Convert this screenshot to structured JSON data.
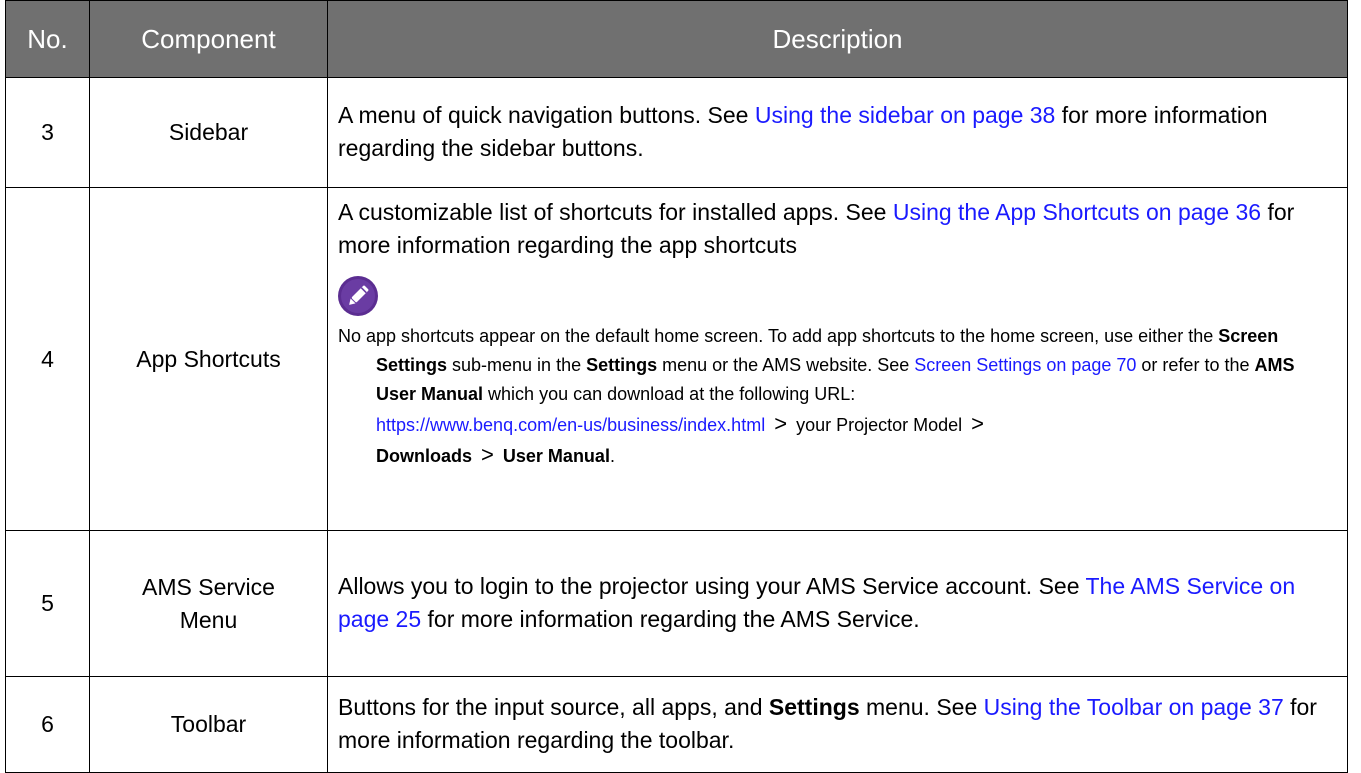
{
  "headers": {
    "no": "No.",
    "component": "Component",
    "description": "Description"
  },
  "rows": [
    {
      "no": "3",
      "component": "Sidebar",
      "desc": {
        "t1": "A menu of quick navigation buttons. See ",
        "link1": "Using the sidebar on page 38",
        "t2": " for more information regarding the sidebar buttons."
      }
    },
    {
      "no": "4",
      "component": "App Shortcuts",
      "desc": {
        "t1": "A customizable list of shortcuts for installed apps. See ",
        "link1": "Using the App Shortcuts on page 36",
        "t2": " for more information regarding the app shortcuts"
      },
      "note": {
        "icon": "pencil-note-icon",
        "icon_color": "#5b2d91",
        "p1": "No app shortcuts appear on the default home screen. To add app shortcuts to the home screen, use either the ",
        "b1": "Screen Settings",
        "p2": " sub-menu in the ",
        "b2": "Settings",
        "p3": " menu or the AMS website. See ",
        "link1": "Screen Settings on page 70",
        "p4": " or refer to the ",
        "b3": "AMS User Manual",
        "p5": " which you can download at the following URL: ",
        "url": "https://www.benq.com/en-us/business/index.html",
        "gt1": ">",
        "p6": " your Projector Model ",
        "gt2": ">",
        "b4": "Downloads",
        "gt3": ">",
        "b5": "User Manual",
        "p7": "."
      }
    },
    {
      "no": "5",
      "component": "AMS Service Menu",
      "desc": {
        "t1": "Allows you to login to the projector using your AMS Service account. See ",
        "link1": "The AMS Service on page 25",
        "t2": " for more information regarding the AMS Service."
      }
    },
    {
      "no": "6",
      "component": "Toolbar",
      "desc": {
        "t1": "Buttons for the input source, all apps, and ",
        "b1": "Settings",
        "t2": " menu. See ",
        "link1": "Using the Toolbar on page 37",
        "t3": " for more information regarding the toolbar."
      }
    }
  ],
  "colors": {
    "header_bg": "#707070",
    "link": "#1a1aff"
  }
}
